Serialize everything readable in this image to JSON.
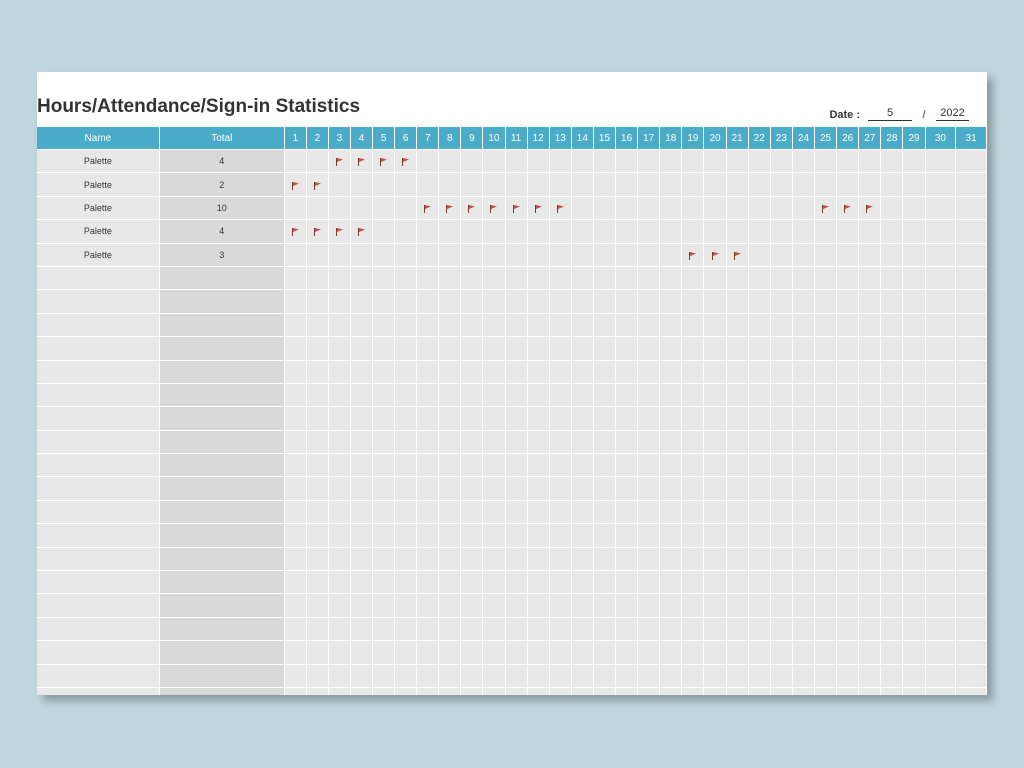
{
  "title": "Hours/Attendance/Sign-in Statistics",
  "date": {
    "label": "Date :",
    "month": "5",
    "separator": "/",
    "year": "2022"
  },
  "columns": {
    "name": "Name",
    "total": "Total",
    "days": [
      "1",
      "2",
      "3",
      "4",
      "5",
      "6",
      "7",
      "8",
      "9",
      "10",
      "11",
      "12",
      "13",
      "14",
      "15",
      "16",
      "17",
      "18",
      "19",
      "20",
      "21",
      "22",
      "23",
      "24",
      "25",
      "26",
      "27",
      "28",
      "29",
      "30",
      "31"
    ]
  },
  "rows": [
    {
      "name": "Palette",
      "total": "4",
      "flags": [
        3,
        4,
        5,
        6
      ]
    },
    {
      "name": "Palette",
      "total": "2",
      "flags": [
        1,
        2
      ]
    },
    {
      "name": "Palette",
      "total": "10",
      "flags": [
        7,
        8,
        9,
        10,
        11,
        12,
        13,
        25,
        26,
        27
      ]
    },
    {
      "name": "Palette",
      "total": "4",
      "flags": [
        1,
        2,
        3,
        4
      ]
    },
    {
      "name": "Palette",
      "total": "3",
      "flags": [
        19,
        20,
        21
      ]
    }
  ],
  "empty_rows": 19,
  "colors": {
    "header": "#4aacc8",
    "cell": "#e8e8e8",
    "total_cell": "#d9d9d9",
    "flag": "#c0504d",
    "background": "#bfd6de"
  },
  "icons": {
    "attendance_mark": "flag-icon"
  }
}
